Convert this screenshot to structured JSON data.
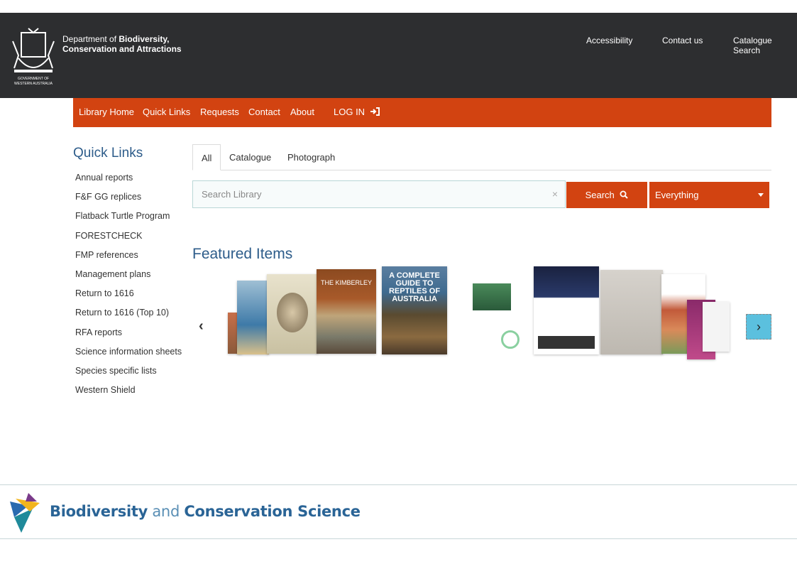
{
  "header": {
    "dept_line1_prefix": "Department of ",
    "dept_line1_bold": "Biodiversity,",
    "dept_line2": "Conservation and Attractions",
    "crest_caption": "GOVERNMENT OF WESTERN AUSTRALIA",
    "links": [
      "Accessibility",
      "Contact us",
      "Catalogue Search"
    ]
  },
  "nav": {
    "items": [
      "Library Home",
      "Quick Links",
      "Requests",
      "Contact",
      "About",
      "LOG IN"
    ]
  },
  "quick_links": {
    "title": "Quick Links",
    "items": [
      "Annual reports",
      "F&F GG replices",
      "Flatback Turtle Program",
      "FORESTCHECK",
      "FMP references",
      "Management plans",
      "Return to 1616",
      "Return to 1616 (Top 10)",
      "RFA reports",
      "Science information sheets",
      "Species specific lists",
      "Western Shield"
    ]
  },
  "search": {
    "tabs": [
      "All",
      "Catalogue",
      "Photograph"
    ],
    "placeholder": "Search Library",
    "clear": "×",
    "button": "Search",
    "scope": "Everything"
  },
  "featured": {
    "title": "Featured Items",
    "prev": "‹",
    "next": "›",
    "books": [
      {
        "title": "THE KIMBERLEY"
      },
      {
        "title": "A COMPLETE GUIDE TO REPTILES OF AUSTRALIA"
      }
    ]
  },
  "footer": {
    "brand_bold1": "Biodiversity",
    "brand_and": " and ",
    "brand_bold2": "Conservation Science"
  },
  "colors": {
    "header_bg": "#2d2e30",
    "accent": "#d24311",
    "link_blue": "#2d5c8a",
    "next_btn": "#5bc0de"
  }
}
